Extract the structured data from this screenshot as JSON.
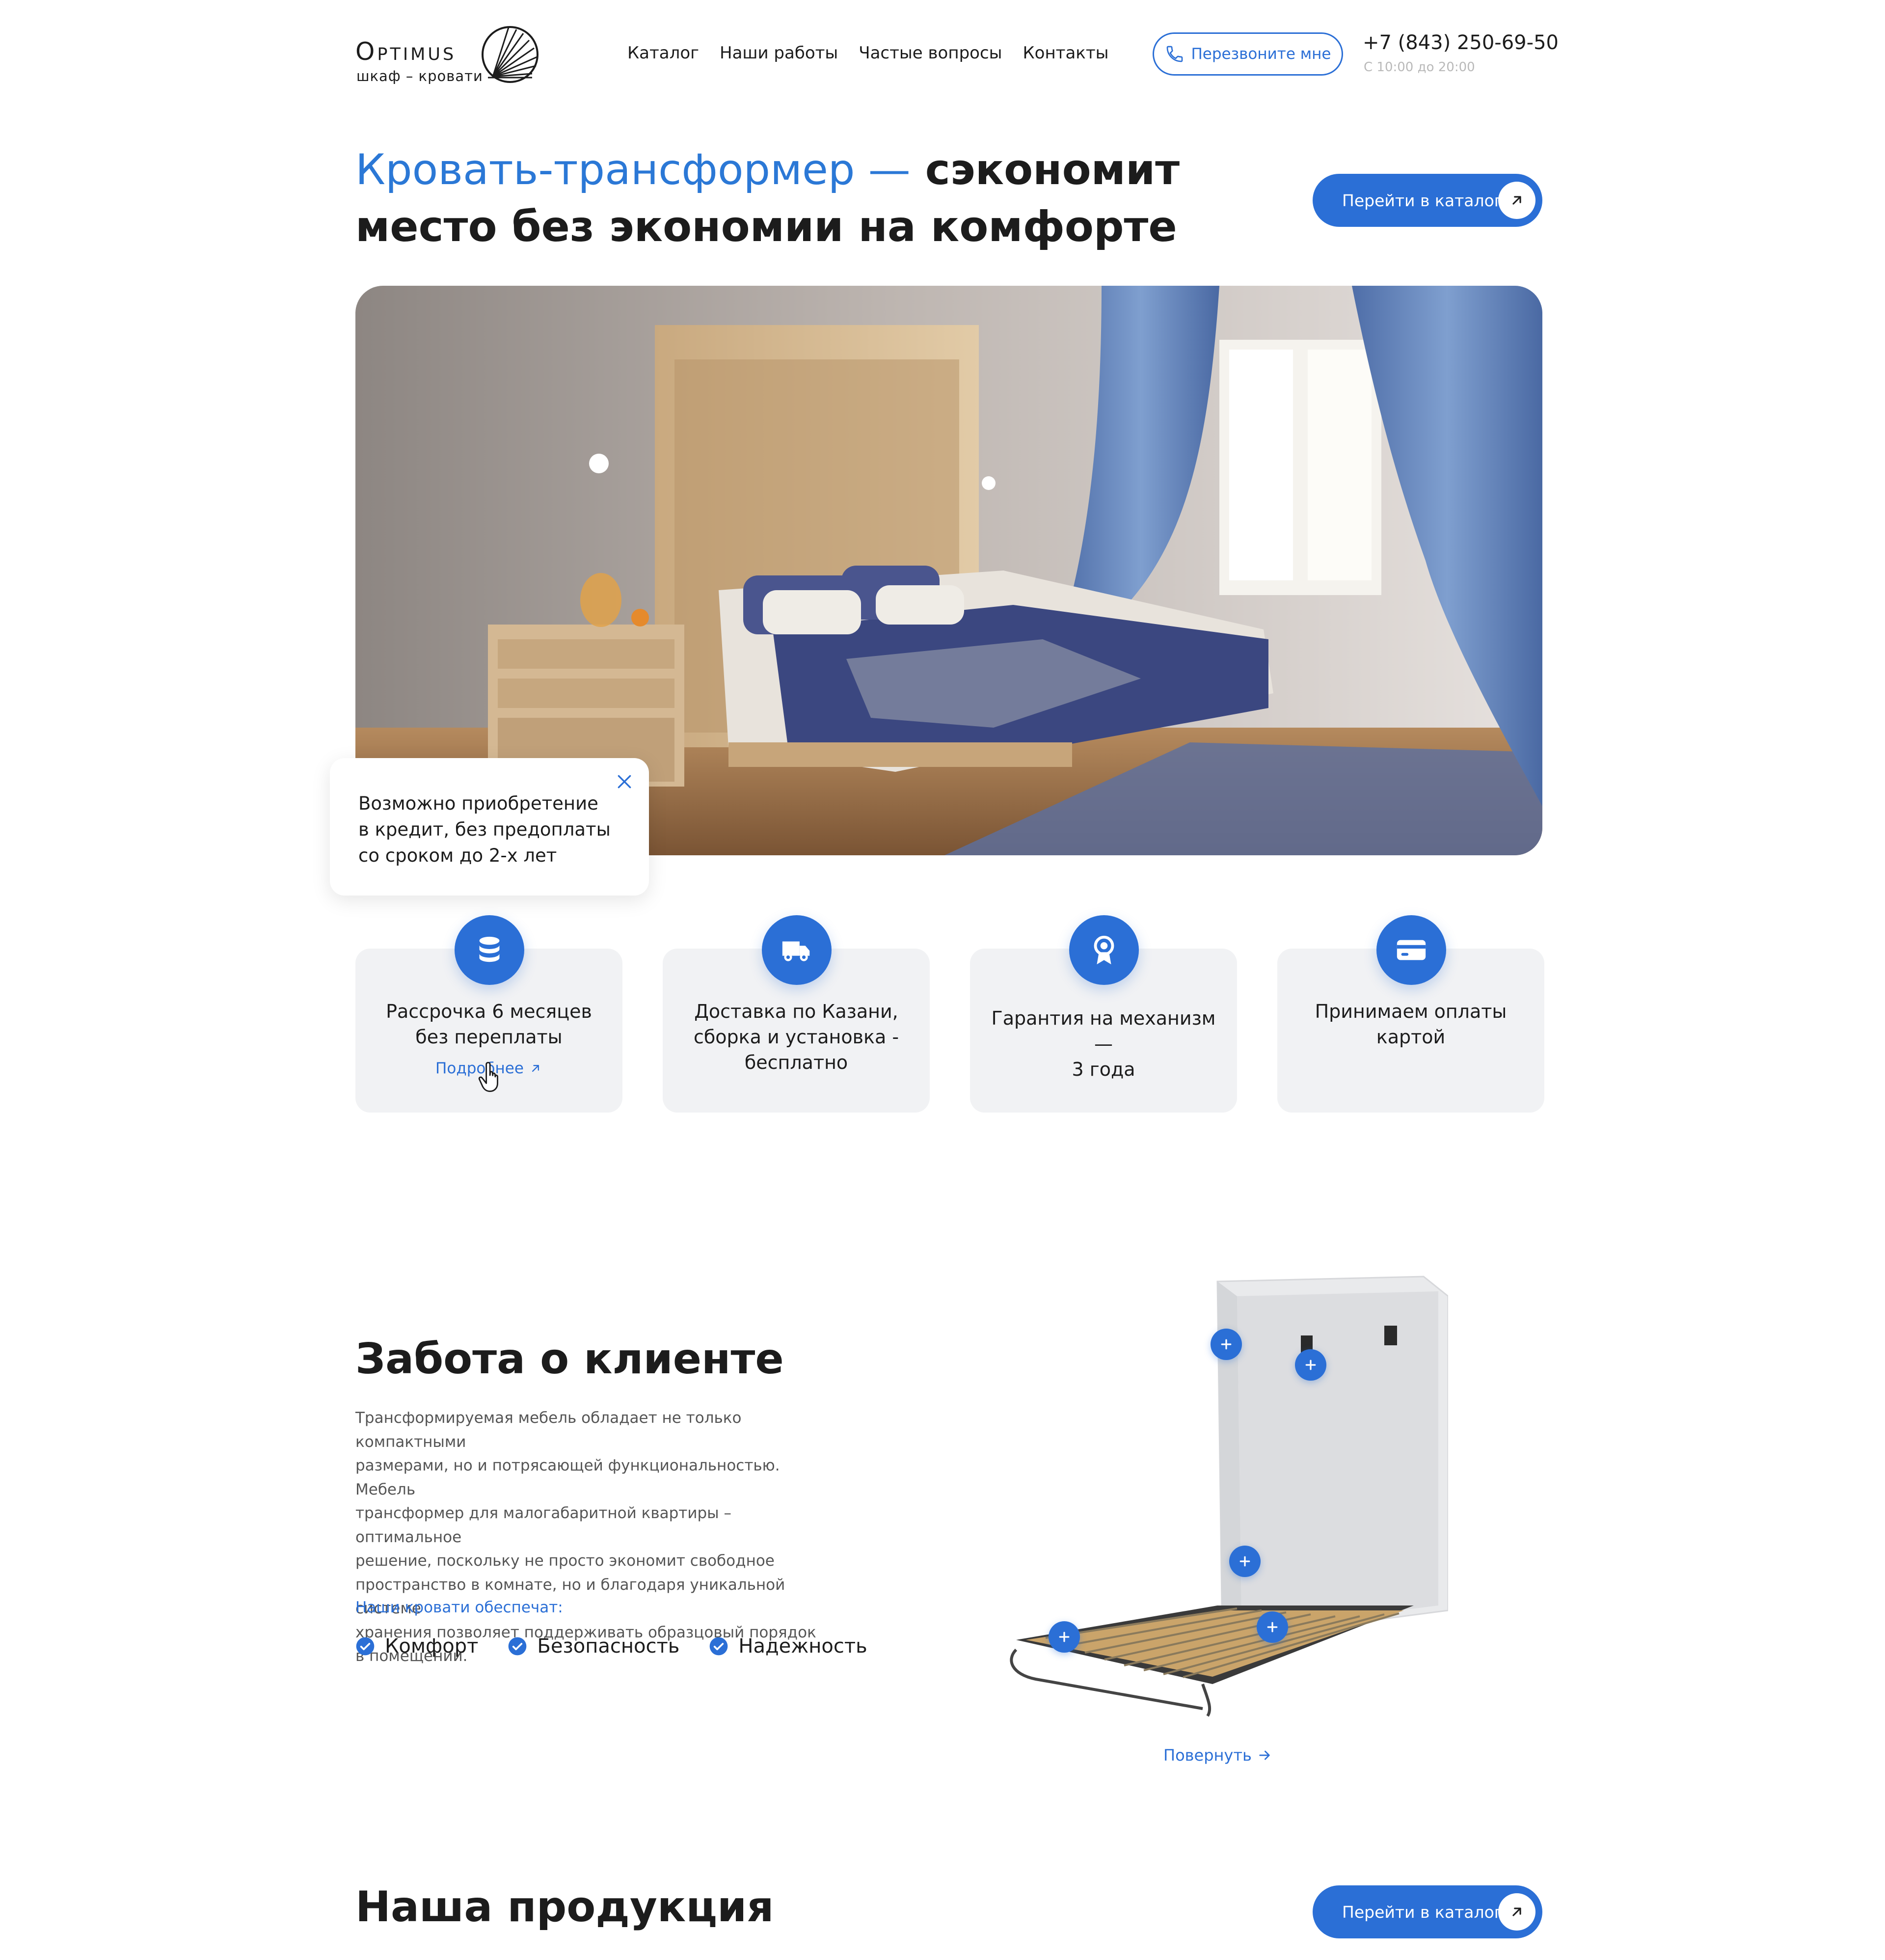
{
  "header": {
    "logo_word": "Optimus",
    "logo_sub": "шкаф – кровати",
    "nav": [
      "Каталог",
      "Наши работы",
      "Частые вопросы",
      "Контакты"
    ],
    "callback_label": "Перезвоните мне",
    "phone": "+7 (843) 250-69-50",
    "hours": "С 10:00 до 20:00"
  },
  "hero": {
    "title_blue": "Кровать-трансформер —",
    "title_dark": "сэкономит место без экономии на комфорте",
    "catalog_button": "Перейти в каталог",
    "credit_line1": "Возможно приобретение",
    "credit_line2": "в кредит, без предоплаты",
    "credit_line3": "со сроком до 2-х лет"
  },
  "features": [
    {
      "line1": "Рассрочка 6 месяцев",
      "line2": "без переплаты",
      "line3": "",
      "link": "Подробнее",
      "icon": "coins-icon"
    },
    {
      "line1": "Доставка по Казани,",
      "line2": "сборка и установка -",
      "line3": "бесплатно",
      "icon": "truck-icon"
    },
    {
      "line1": "Гарантия на механизм —",
      "line2": "3 года",
      "line3": "",
      "icon": "award-icon"
    },
    {
      "line1": "Принимаем оплаты",
      "line2": "картой",
      "line3": "",
      "icon": "credit-card-icon"
    }
  ],
  "care": {
    "title": "Забота о клиенте",
    "text": [
      "Трансформируемая мебель обладает не только компактными",
      "размерами, но и потрясающей функциональностью. Мебель",
      "трансформер для малогабаритной квартиры – оптимальное",
      "решение, поскольку не просто экономит свободное",
      "пространство в комнате, но и благодаря уникальной системе",
      "хранения позволяет поддерживать образцовый порядок",
      "в помещении."
    ],
    "subtitle": "Наши кровати обеспечат:",
    "checks": [
      "Комфорт",
      "Безопасность",
      "Надежность"
    ],
    "rotate": "Повернуть"
  },
  "products": {
    "title": "Наша продукция",
    "catalog_button": "Перейти в каталог"
  },
  "colors": {
    "accent": "#2b6fd6",
    "card_bg": "#f1f2f4",
    "text": "#1c1c1c"
  }
}
